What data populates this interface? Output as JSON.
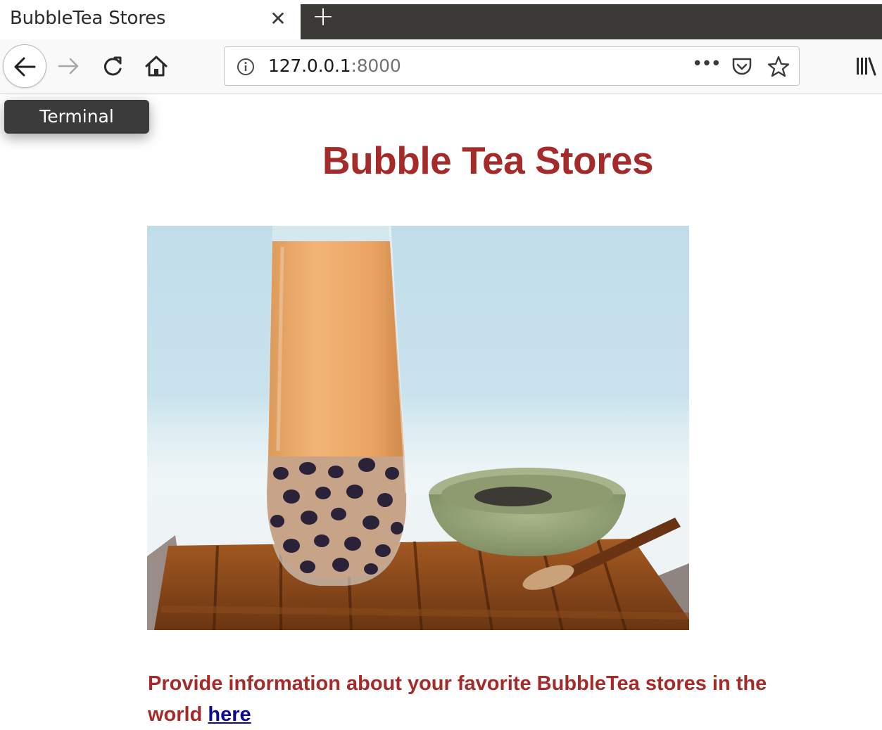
{
  "browser": {
    "tab_title": "BubbleTea Stores",
    "tab_close": "✕",
    "new_tab": "+",
    "url_host": "127.0.0.1",
    "url_port": ":8000",
    "page_actions": "•••"
  },
  "tooltip": {
    "label": "Terminal"
  },
  "page": {
    "title": "Bubble Tea Stores",
    "intro_text": "Provide information about your favorite BubbleTea stores in the world",
    "intro_link": "here"
  },
  "colors": {
    "heading": "#a52a2a",
    "link": "#0b0b95",
    "tab_strip_dark": "#3b3a37"
  }
}
